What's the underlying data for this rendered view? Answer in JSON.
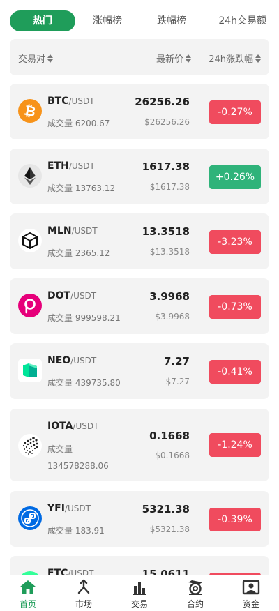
{
  "tabs": [
    {
      "label": "热门"
    },
    {
      "label": "涨幅榜"
    },
    {
      "label": "跌幅榜"
    },
    {
      "label": "24h交易额"
    }
  ],
  "header": {
    "pair": "交易对",
    "price": "最新价",
    "change": "24h涨跌幅"
  },
  "coins": [
    {
      "base": "BTC",
      "quote": "/USDT",
      "volume": "成交量 6200.67",
      "price": "26256.26",
      "usd": "$26256.26",
      "change": "-0.27%",
      "icon": "bitcoin-icon",
      "color": "#f7931a"
    },
    {
      "base": "ETH",
      "quote": "/USDT",
      "volume": "成交量 13763.12",
      "price": "1617.38",
      "usd": "$1617.38",
      "change": "+0.26%",
      "icon": "ethereum-icon",
      "color": "#e6e6e6"
    },
    {
      "base": "MLN",
      "quote": "/USDT",
      "volume": "成交量 2365.12",
      "price": "13.3518",
      "usd": "$13.3518",
      "change": "-3.23%",
      "icon": "melon-icon",
      "color": "#ffffff"
    },
    {
      "base": "DOT",
      "quote": "/USDT",
      "volume": "成交量 999598.21",
      "price": "3.9968",
      "usd": "$3.9968",
      "change": "-0.73%",
      "icon": "polkadot-icon",
      "color": "#e6007a"
    },
    {
      "base": "NEO",
      "quote": "/USDT",
      "volume": "成交量 439735.80",
      "price": "7.27",
      "usd": "$7.27",
      "change": "-0.41%",
      "icon": "neo-icon",
      "color": "#00e599"
    },
    {
      "base": "IOTA",
      "quote": "/USDT",
      "volume": "成交量 134578288.06",
      "price": "0.1668",
      "usd": "$0.1668",
      "change": "-1.24%",
      "icon": "iota-icon",
      "color": "#ffffff"
    },
    {
      "base": "YFI",
      "quote": "/USDT",
      "volume": "成交量 183.91",
      "price": "5321.38",
      "usd": "$5321.38",
      "change": "-0.39%",
      "icon": "yearn-icon",
      "color": "#006ae3"
    },
    {
      "base": "ETC",
      "quote": "/USDT",
      "volume": "",
      "price": "15.0611",
      "usd": "",
      "change": "",
      "icon": "ethereum-classic-icon",
      "color": "#33ff99"
    }
  ],
  "tabbar": [
    {
      "label": "首页",
      "icon": "home-icon"
    },
    {
      "label": "市场",
      "icon": "market-icon"
    },
    {
      "label": "交易",
      "icon": "trade-icon"
    },
    {
      "label": "合约",
      "icon": "contract-icon"
    },
    {
      "label": "资金",
      "icon": "assets-icon"
    }
  ],
  "colors": {
    "accent": "#1f9d5a",
    "down": "#f04b5e",
    "up": "#2fb37a",
    "card": "#f3f3f3"
  }
}
